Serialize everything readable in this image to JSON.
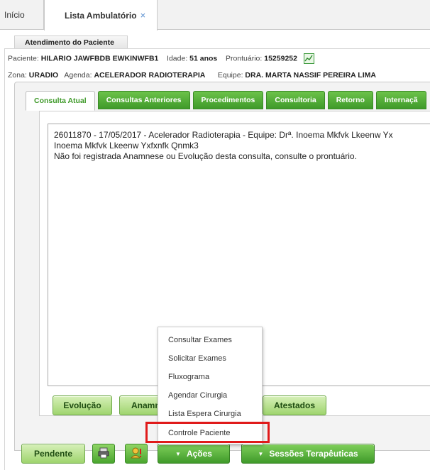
{
  "top_tabs": {
    "inicio": "Início",
    "active": "Lista Ambulatório",
    "close_glyph": "×"
  },
  "section": {
    "title": "Atendimento do Paciente"
  },
  "patient": {
    "paciente_label": "Paciente:",
    "paciente_value": "HILARIO JAWFBDB EWKINWFB1",
    "idade_label": "Idade:",
    "idade_value": "51 anos",
    "prontuario_label": "Prontuário:",
    "prontuario_value": "15259252",
    "zona_label": "Zona:",
    "zona_value": "URADIO",
    "agenda_label": "Agenda:",
    "agenda_value": "ACELERADOR RADIOTERAPIA",
    "equipe_label": "Equipe:",
    "equipe_value": "DRA. MARTA NASSIF PEREIRA LIMA"
  },
  "inner_tabs": [
    {
      "label": "Consulta Atual"
    },
    {
      "label": "Consultas Anteriores"
    },
    {
      "label": "Procedimentos"
    },
    {
      "label": "Consultoria"
    },
    {
      "label": "Retorno"
    },
    {
      "label": "Internaçã"
    }
  ],
  "consulta_text": {
    "line1": "26011870 - 17/05/2017 - Acelerador Radioterapia - Equipe: Drª. Inoema Mkfvk Lkeenw Yx",
    "line2": "Inoema Mkfvk Lkeenw Yxfxnfk Qnmk3",
    "line3": "Não foi registrada Anamnese ou Evolução desta consulta, consulte o prontuário."
  },
  "action_buttons": {
    "evolucao": "Evolução",
    "anamnese": "Anamnese",
    "atestados": "Atestados"
  },
  "acoes_menu": {
    "items": [
      "Consultar Exames",
      "Solicitar Exames",
      "Fluxograma",
      "Agendar Cirurgia",
      "Lista Espera Cirurgia",
      "Controle Paciente"
    ]
  },
  "bottom_bar": {
    "pendente": "Pendente",
    "acoes": "Ações",
    "sessoes": "Sessões Terapêuticas"
  },
  "colors": {
    "green_dark": "#3f9a2a",
    "green_light": "#9fd46e",
    "highlight_red": "#e01a1a"
  }
}
